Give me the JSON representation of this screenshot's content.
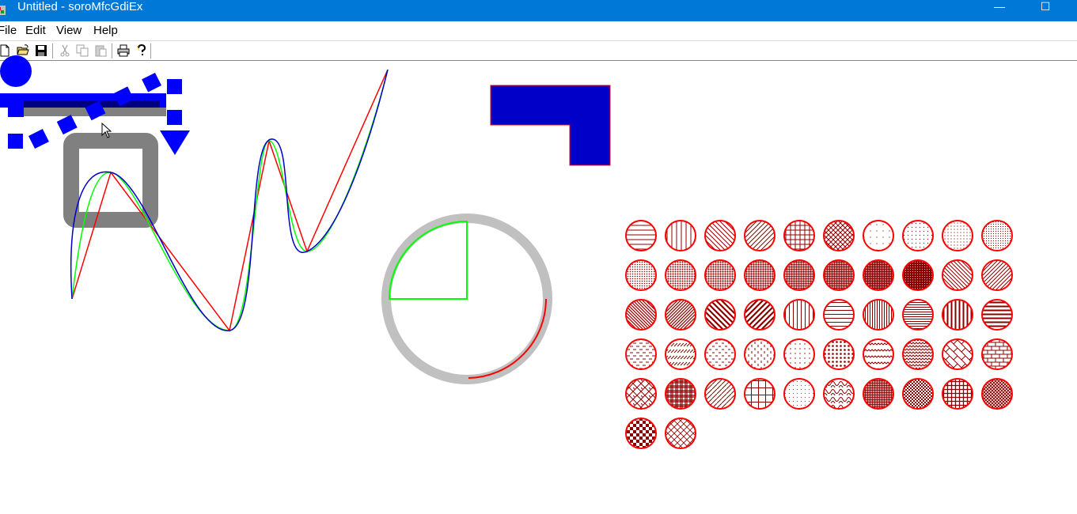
{
  "window": {
    "title": "Untitled - soroMfcGdiEx",
    "minimize_glyph": "—",
    "maximize_glyph": "☐"
  },
  "menu": [
    "File",
    "Edit",
    "View",
    "Help"
  ],
  "toolbar": {
    "buttons": [
      "new-file-icon",
      "open-folder-icon",
      "save-icon",
      "cut-icon",
      "copy-icon",
      "paste-icon",
      "print-icon",
      "help-icon"
    ],
    "disabled": [
      "cut-icon",
      "copy-icon",
      "paste-icon"
    ]
  },
  "colors": {
    "titlebar": "#0078d7",
    "blue": "#0000ff",
    "dark_blue": "#0000c8",
    "red": "#ff0000",
    "dark_red": "#8b0000",
    "green": "#00ff00",
    "gray": "#808080",
    "light_gray": "#c0c0c0"
  },
  "hatch_pattern_count": 52
}
